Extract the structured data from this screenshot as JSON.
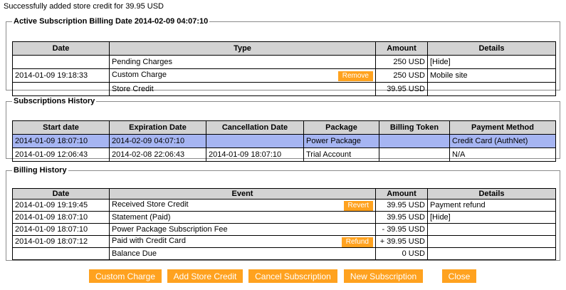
{
  "status_message": "Successfully added store credit for 39.95 USD",
  "active_billing": {
    "legend": "Active Subscription Billing Date 2014-02-09 04:07:10",
    "headers": {
      "date": "Date",
      "type": "Type",
      "amount": "Amount",
      "details": "Details"
    },
    "rows": [
      {
        "date": "",
        "type": "Pending Charges",
        "action": "",
        "amount": "250 USD",
        "details": "[Hide]"
      },
      {
        "date": "2014-01-09 19:18:33",
        "type": "Custom Charge",
        "action": "Remove",
        "amount": "250 USD",
        "details": "Mobile site"
      },
      {
        "date": "",
        "type": "Store Credit",
        "action": "",
        "amount": "39.95 USD",
        "details": ""
      }
    ]
  },
  "subscriptions_history": {
    "legend": "Subscriptions History",
    "headers": {
      "start": "Start date",
      "expiration": "Expiration Date",
      "cancellation": "Cancellation Date",
      "package": "Package",
      "token": "Billing Token",
      "payment": "Payment Method"
    },
    "rows": [
      {
        "start": "2014-01-09 18:07:10",
        "expiration": "2014-02-09 04:07:10",
        "cancellation": "",
        "package": "Power Package",
        "token": "",
        "payment": "Credit Card (AuthNet)"
      },
      {
        "start": "2014-01-09 12:06:43",
        "expiration": "2014-02-08 22:06:43",
        "cancellation": "2014-01-09 18:07:10",
        "package": "Trial Account",
        "token": "",
        "payment": "N/A"
      }
    ]
  },
  "billing_history": {
    "legend": "Billing History",
    "headers": {
      "date": "Date",
      "event": "Event",
      "amount": "Amount",
      "details": "Details"
    },
    "rows": [
      {
        "date": "2014-01-09 19:19:45",
        "event": "Received Store Credit",
        "action": "Revert",
        "amount": "39.95 USD",
        "details": "Payment refund"
      },
      {
        "date": "2014-01-09 18:07:10",
        "event": "Statement (Paid)",
        "action": "",
        "amount": "39.95 USD",
        "details": "[Hide]"
      },
      {
        "date": "2014-01-09 18:07:10",
        "event": "Power Package Subscription Fee",
        "action": "",
        "amount": "- 39.95 USD",
        "details": ""
      },
      {
        "date": "2014-01-09 18:07:12",
        "event": "Paid with Credit Card",
        "action": "Refund",
        "amount": "+ 39.95 USD",
        "details": ""
      },
      {
        "date": "",
        "event": "Balance Due",
        "action": "",
        "amount": "0 USD",
        "details": ""
      }
    ]
  },
  "actions": {
    "custom_charge": "Custom Charge",
    "add_store_credit": "Add Store Credit",
    "cancel_subscription": "Cancel Subscription",
    "new_subscription": "New Subscription",
    "close": "Close"
  },
  "colors": {
    "accent": "#ffa21f",
    "selected_row": "#a6b5f2",
    "header_bg": "#d3d3d3"
  }
}
